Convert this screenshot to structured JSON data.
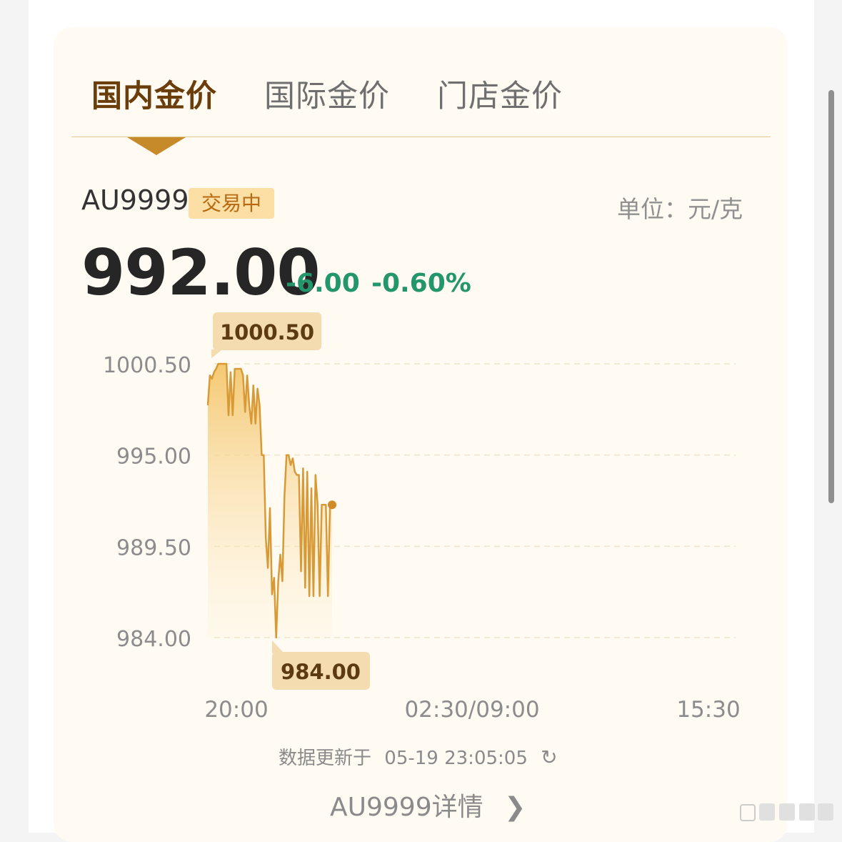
{
  "tabs": [
    {
      "label": "国内金价",
      "active": true
    },
    {
      "label": "国际金价",
      "active": false
    },
    {
      "label": "门店金价",
      "active": false
    }
  ],
  "quote": {
    "symbol": "AU9999",
    "status": "交易中",
    "unit": "单位：元/克",
    "price": "992.00",
    "change": "-6.00",
    "change_pct": "-0.60%"
  },
  "colors": {
    "accent_brown": "#6b3d0b",
    "gold_line": "#d79a36",
    "down_green": "#23966b",
    "card_bg": "#fffbf2"
  },
  "chart_data": {
    "type": "area",
    "y_ticks": [
      "1000.50",
      "995.00",
      "989.50",
      "984.00"
    ],
    "x_ticks": [
      "20:00",
      "02:30/09:00",
      "15:30"
    ],
    "ylim": [
      984.0,
      1000.5
    ],
    "high_label": "1000.50",
    "low_label": "984.00",
    "grid": true,
    "series": [
      {
        "values": [
          998.0,
          999.8,
          999.6,
          1000.0,
          1000.2,
          1000.5,
          1000.5,
          1000.5,
          1000.5,
          1000.5,
          997.4,
          1000.0,
          997.4,
          1000.2,
          1000.2,
          1000.2,
          1000.2,
          999.8,
          997.6,
          999.8,
          998.0,
          996.9,
          999.2,
          996.9,
          999.0,
          998.0,
          995.0,
          995.0,
          990.0,
          988.2,
          991.8,
          986.6,
          987.6,
          984.0,
          987.4,
          989.0,
          987.4,
          992.5,
          995.0,
          995.0,
          994.4,
          994.8,
          994.0,
          993.8,
          993.8,
          988.0,
          994.2,
          987.0,
          994.0,
          986.5,
          993.0,
          986.5,
          993.8,
          992.0,
          986.5,
          992.0,
          992.0,
          992.0,
          986.5,
          992.0,
          992.0
        ]
      }
    ],
    "last_point": 992.0
  },
  "footer": {
    "update_prefix": "数据更新于",
    "update_time": "05-19 23:05:05",
    "refresh_icon": "refresh-icon",
    "detail_link": "AU9999详情",
    "chevron_icon": "chevron-right-icon"
  }
}
